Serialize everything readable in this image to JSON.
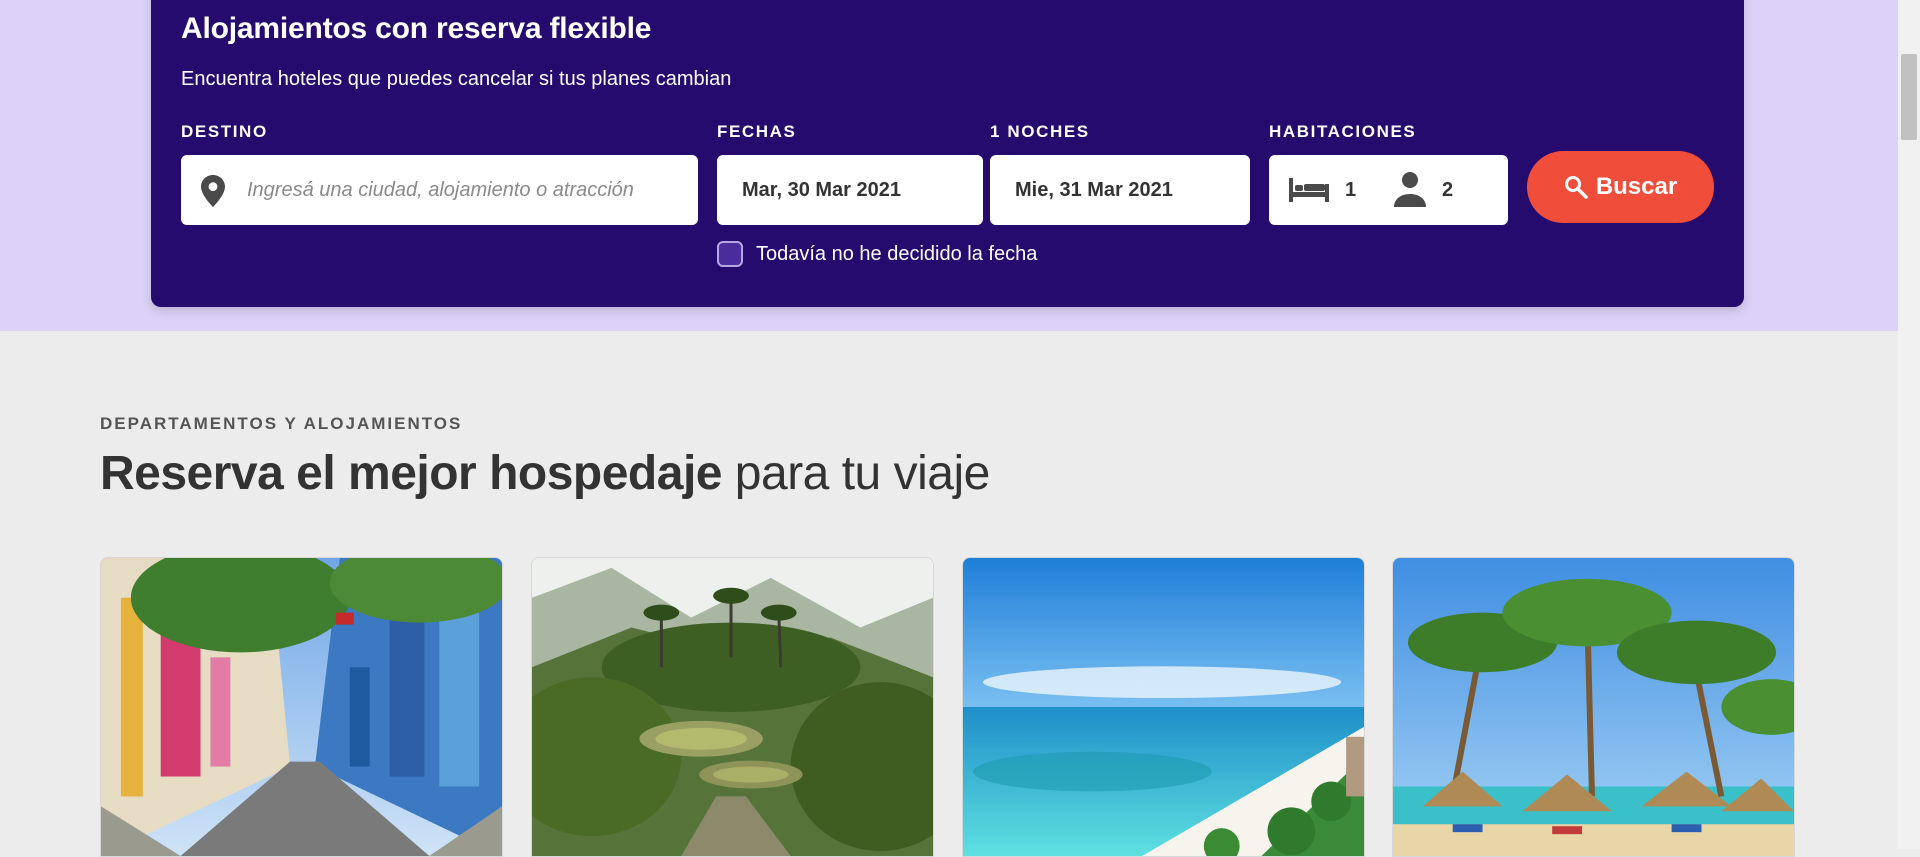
{
  "search": {
    "title": "Alojamientos con reserva flexible",
    "subtitle": "Encuentra hoteles que puedes cancelar si tus planes cambian",
    "destination_label": "DESTINO",
    "destination_placeholder": "Ingresá una ciudad, alojamiento o atracción",
    "dates_label": "FECHAS",
    "nights_label": "1 NOCHES",
    "checkin": "Mar, 30 Mar 2021",
    "checkout": "Mie, 31 Mar 2021",
    "rooms_label": "HABITACIONES",
    "rooms": "1",
    "guests": "2",
    "button_label": "Buscar",
    "no_dates_label": "Todavía no he decidido la fecha",
    "no_dates_checked": false
  },
  "section": {
    "eyebrow": "DEPARTAMENTOS Y ALOJAMIENTOS",
    "title_bold": "Reserva el mejor hospedaje",
    "title_regular": " para tu viaje"
  },
  "cards": [
    {
      "scene": "colonial-street"
    },
    {
      "scene": "jungle-ruins"
    },
    {
      "scene": "turquoise-beach"
    },
    {
      "scene": "palm-umbrella-beach"
    }
  ],
  "colors": {
    "brand_purple": "#260b6f",
    "hero_lavender": "#dcd2f7",
    "search_button": "#f04e3a"
  },
  "icons": [
    "map-pin-icon",
    "bed-icon",
    "person-icon",
    "search-icon"
  ]
}
